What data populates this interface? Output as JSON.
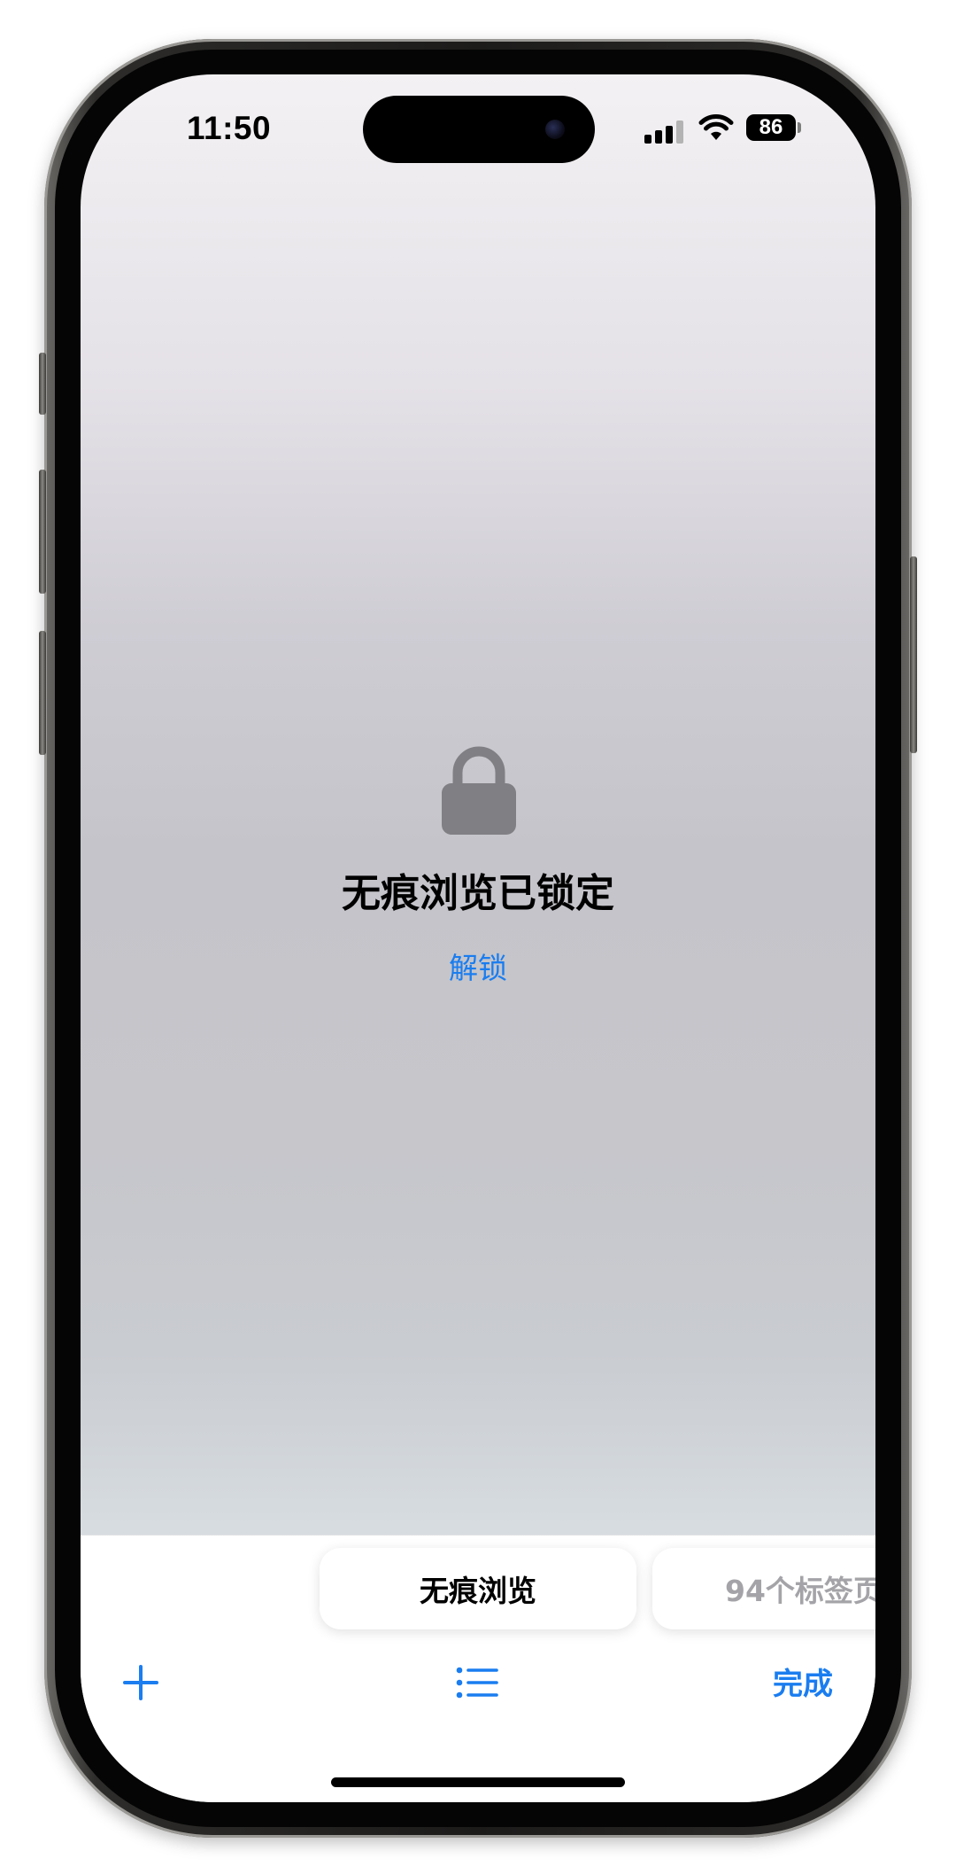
{
  "status_bar": {
    "time": "11:50",
    "battery_level": "86",
    "icons": [
      "cellular-signal-icon",
      "wifi-icon",
      "battery-icon"
    ]
  },
  "lock_screen": {
    "icon": "lock-icon",
    "title": "无痕浏览已锁定",
    "unlock_label": "解锁"
  },
  "tab_groups": [
    {
      "label": "无痕浏览",
      "selected": true
    },
    {
      "label": "94个标签页",
      "selected": false
    }
  ],
  "toolbar": {
    "new_tab_icon": "plus-icon",
    "tab_groups_icon": "list-icon",
    "done_label": "完成"
  },
  "colors": {
    "accent": "#1a7df0",
    "lock_icon": "#808084",
    "muted_text": "#a4a4a8"
  }
}
